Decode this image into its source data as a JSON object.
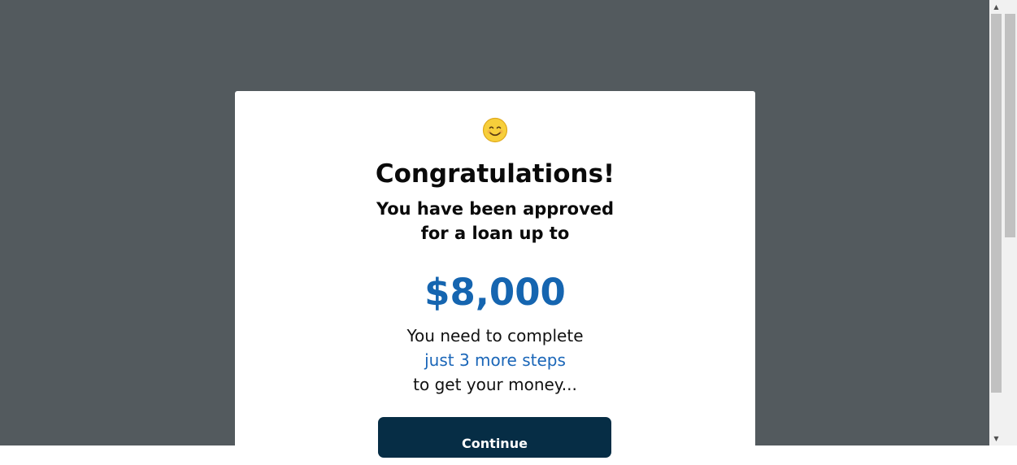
{
  "modal": {
    "icon": "smiling-face-icon",
    "title": "Congratulations!",
    "subtitle_line1": "You have been approved",
    "subtitle_line2": "for a loan up to",
    "amount": "$8,000",
    "steps_line1": "You need to complete",
    "steps_highlight": "just 3 more steps",
    "steps_line3": "to get your money...",
    "continue_label": "Continue"
  },
  "colors": {
    "overlay": "#535a5e",
    "accent": "#1565b0",
    "button": "#062d45"
  },
  "scrollbar": {
    "up_arrow": "▲",
    "down_arrow": "▼"
  }
}
